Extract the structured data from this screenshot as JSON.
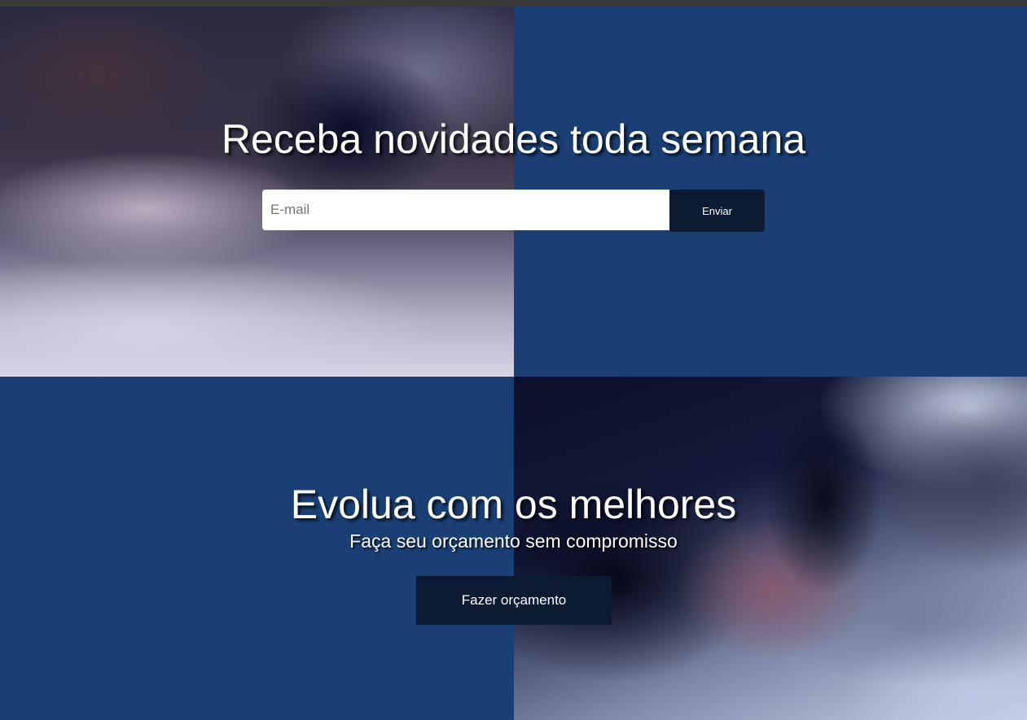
{
  "newsletter": {
    "title": "Receba novidades toda semana",
    "email_placeholder": "E-mail",
    "send_label": "Enviar"
  },
  "budget": {
    "title": "Evolua com os melhores",
    "subtitle": "Faça seu orçamento sem compromisso",
    "button_label": "Fazer orçamento"
  },
  "colors": {
    "blue_panel": "#1a3f74",
    "button_dark": "#0c1a32",
    "text": "#ffffff"
  }
}
